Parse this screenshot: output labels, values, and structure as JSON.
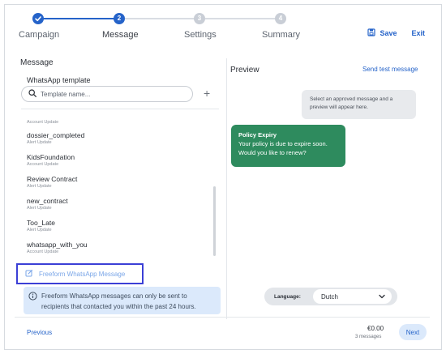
{
  "stepper": {
    "steps": [
      {
        "label": "Campaign",
        "number": "1",
        "state": "done"
      },
      {
        "label": "Message",
        "number": "2",
        "state": "active"
      },
      {
        "label": "Settings",
        "number": "3",
        "state": "todo"
      },
      {
        "label": "Summary",
        "number": "4",
        "state": "todo"
      }
    ],
    "save_label": "Save",
    "exit_label": "Exit"
  },
  "message_panel": {
    "title": "Message",
    "template_label": "WhatsApp template",
    "search_placeholder": "Template name...",
    "templates": [
      {
        "name": "",
        "category": "Account Update"
      },
      {
        "name": "dossier_completed",
        "category": "Alert Update"
      },
      {
        "name": "KidsFoundation",
        "category": "Account Update"
      },
      {
        "name": "Review Contract",
        "category": "Alert Update"
      },
      {
        "name": "new_contract",
        "category": "Alert Update"
      },
      {
        "name": "Too_Late",
        "category": "Alert Update"
      },
      {
        "name": "whatsapp_with_you",
        "category": "Account Update"
      }
    ],
    "freeform_label": "Freeform WhatsApp Message",
    "info_text": "Freeform WhatsApp messages can only be sent to recipients that contacted you within the past 24 hours."
  },
  "preview": {
    "title": "Preview",
    "send_test_label": "Send test message",
    "placeholder_bubble": "Select an approved message and a preview will appear here.",
    "message_title": "Policy Expiry",
    "message_body": "Your policy is due to expire soon. Would you like to renew?",
    "language_label": "Language:",
    "language_value": "Dutch"
  },
  "footer": {
    "previous_label": "Previous",
    "price": "€0.00",
    "message_count": "3 messages",
    "next_label": "Next"
  },
  "colors": {
    "accent": "#2563c9",
    "bubble_green": "#2e8b5e",
    "highlight_border": "#3b3fd6",
    "info_bg": "#dbe9fb"
  }
}
